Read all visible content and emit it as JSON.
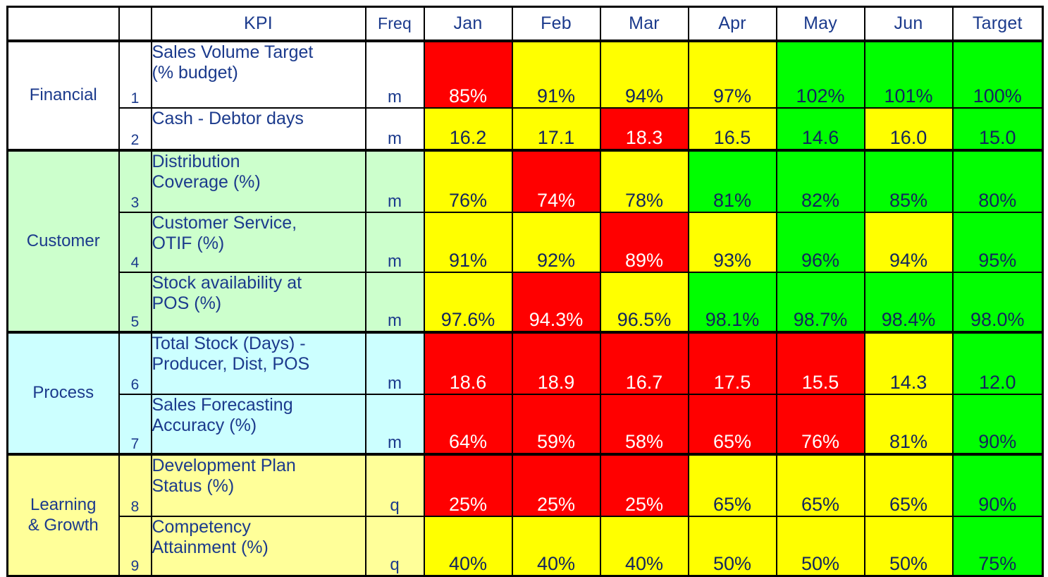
{
  "title": "Balanced Scorecard KPI Table",
  "columns": {
    "perspective": "",
    "number": "",
    "kpi": "KPI",
    "freq": "Freq",
    "months": [
      "Jan",
      "Feb",
      "Mar",
      "Apr",
      "May",
      "Jun"
    ],
    "target": "Target"
  },
  "colors": {
    "red": "#FF0000",
    "yellow": "#FFFF00",
    "green": "#00FF00",
    "text_blue": "#1B3A8C",
    "text_on_red": "#FFFFFF",
    "tint_financial": "#FFFFFF",
    "tint_customer": "#CCFFCC",
    "tint_process": "#CCFFFF",
    "tint_learning": "#FFFF99",
    "border": "#000000"
  },
  "sections": [
    {
      "name": "Financial",
      "tint": "#FFFFFF",
      "rows": [
        {
          "num": "1",
          "kpi": "Sales Volume Target (% budget)",
          "kpi_lines": [
            "Sales Volume Target",
            "(% budget)"
          ],
          "freq": "m",
          "cells": [
            {
              "value": "85%",
              "status": "red"
            },
            {
              "value": "91%",
              "status": "yellow"
            },
            {
              "value": "94%",
              "status": "yellow"
            },
            {
              "value": "97%",
              "status": "yellow"
            },
            {
              "value": "102%",
              "status": "green"
            },
            {
              "value": "101%",
              "status": "green"
            }
          ],
          "target": {
            "value": "100%",
            "status": "green"
          }
        },
        {
          "num": "2",
          "kpi": "Cash - Debtor days",
          "kpi_lines": [
            "Cash - Debtor days"
          ],
          "freq": "m",
          "cells": [
            {
              "value": "16.2",
              "status": "yellow"
            },
            {
              "value": "17.1",
              "status": "yellow"
            },
            {
              "value": "18.3",
              "status": "red"
            },
            {
              "value": "16.5",
              "status": "yellow"
            },
            {
              "value": "14.6",
              "status": "green"
            },
            {
              "value": "16.0",
              "status": "yellow"
            }
          ],
          "target": {
            "value": "15.0",
            "status": "green"
          }
        }
      ]
    },
    {
      "name": "Customer",
      "tint": "#CCFFCC",
      "rows": [
        {
          "num": "3",
          "kpi": "Distribution Coverage (%)",
          "kpi_lines": [
            "Distribution",
            "Coverage (%)"
          ],
          "freq": "m",
          "cells": [
            {
              "value": "76%",
              "status": "yellow"
            },
            {
              "value": "74%",
              "status": "red"
            },
            {
              "value": "78%",
              "status": "yellow"
            },
            {
              "value": "81%",
              "status": "green"
            },
            {
              "value": "82%",
              "status": "green"
            },
            {
              "value": "85%",
              "status": "green"
            }
          ],
          "target": {
            "value": "80%",
            "status": "green"
          }
        },
        {
          "num": "4",
          "kpi": "Customer Service, OTIF (%)",
          "kpi_lines": [
            "Customer Service,",
            "OTIF (%)"
          ],
          "freq": "m",
          "cells": [
            {
              "value": "91%",
              "status": "yellow"
            },
            {
              "value": "92%",
              "status": "yellow"
            },
            {
              "value": "89%",
              "status": "red"
            },
            {
              "value": "93%",
              "status": "yellow"
            },
            {
              "value": "96%",
              "status": "green"
            },
            {
              "value": "94%",
              "status": "yellow"
            }
          ],
          "target": {
            "value": "95%",
            "status": "green"
          }
        },
        {
          "num": "5",
          "kpi": "Stock availability at POS (%)",
          "kpi_lines": [
            "Stock availability at",
            "POS (%)"
          ],
          "freq": "m",
          "cells": [
            {
              "value": "97.6%",
              "status": "yellow"
            },
            {
              "value": "94.3%",
              "status": "red"
            },
            {
              "value": "96.5%",
              "status": "yellow"
            },
            {
              "value": "98.1%",
              "status": "green"
            },
            {
              "value": "98.7%",
              "status": "green"
            },
            {
              "value": "98.4%",
              "status": "green"
            }
          ],
          "target": {
            "value": "98.0%",
            "status": "green"
          }
        }
      ]
    },
    {
      "name": "Process",
      "tint": "#CCFFFF",
      "rows": [
        {
          "num": "6",
          "kpi": "Total Stock (Days) - Producer, Dist, POS",
          "kpi_lines": [
            "Total Stock (Days) -",
            "Producer, Dist, POS"
          ],
          "freq": "m",
          "cells": [
            {
              "value": "18.6",
              "status": "red"
            },
            {
              "value": "18.9",
              "status": "red"
            },
            {
              "value": "16.7",
              "status": "red"
            },
            {
              "value": "17.5",
              "status": "red"
            },
            {
              "value": "15.5",
              "status": "red"
            },
            {
              "value": "14.3",
              "status": "yellow"
            }
          ],
          "target": {
            "value": "12.0",
            "status": "green"
          }
        },
        {
          "num": "7",
          "kpi": "Sales Forecasting Accuracy (%)",
          "kpi_lines": [
            "Sales Forecasting",
            "Accuracy (%)"
          ],
          "freq": "m",
          "cells": [
            {
              "value": "64%",
              "status": "red"
            },
            {
              "value": "59%",
              "status": "red"
            },
            {
              "value": "58%",
              "status": "red"
            },
            {
              "value": "65%",
              "status": "red"
            },
            {
              "value": "76%",
              "status": "red"
            },
            {
              "value": "81%",
              "status": "yellow"
            }
          ],
          "target": {
            "value": "90%",
            "status": "green"
          }
        }
      ]
    },
    {
      "name": "Learning & Growth",
      "tint": "#FFFF99",
      "name_lines": [
        "Learning",
        "& Growth"
      ],
      "rows": [
        {
          "num": "8",
          "kpi": "Development Plan Status (%)",
          "kpi_lines": [
            "Development  Plan",
            "Status (%)"
          ],
          "freq": "q",
          "cells": [
            {
              "value": "25%",
              "status": "red"
            },
            {
              "value": "25%",
              "status": "red"
            },
            {
              "value": "25%",
              "status": "red"
            },
            {
              "value": "65%",
              "status": "yellow"
            },
            {
              "value": "65%",
              "status": "yellow"
            },
            {
              "value": "65%",
              "status": "yellow"
            }
          ],
          "target": {
            "value": "90%",
            "status": "green"
          }
        },
        {
          "num": "9",
          "kpi": "Competency Attainment (%)",
          "kpi_lines": [
            "Competency",
            "Attainment (%)"
          ],
          "freq": "q",
          "cells": [
            {
              "value": "40%",
              "status": "yellow"
            },
            {
              "value": "40%",
              "status": "yellow"
            },
            {
              "value": "40%",
              "status": "yellow"
            },
            {
              "value": "50%",
              "status": "yellow"
            },
            {
              "value": "50%",
              "status": "yellow"
            },
            {
              "value": "50%",
              "status": "yellow"
            }
          ],
          "target": {
            "value": "75%",
            "status": "green"
          }
        }
      ]
    }
  ],
  "chart_data": {
    "type": "table",
    "title": "Balanced Scorecard KPI Table",
    "categories": [
      "Jan",
      "Feb",
      "Mar",
      "Apr",
      "May",
      "Jun",
      "Target"
    ],
    "series": [
      {
        "name": "Sales Volume Target (% budget)",
        "perspective": "Financial",
        "freq": "m",
        "values": [
          "85%",
          "91%",
          "94%",
          "97%",
          "102%",
          "101%",
          "100%"
        ],
        "status": [
          "red",
          "yellow",
          "yellow",
          "yellow",
          "green",
          "green",
          "green"
        ]
      },
      {
        "name": "Cash - Debtor days",
        "perspective": "Financial",
        "freq": "m",
        "values": [
          "16.2",
          "17.1",
          "18.3",
          "16.5",
          "14.6",
          "16.0",
          "15.0"
        ],
        "status": [
          "yellow",
          "yellow",
          "red",
          "yellow",
          "green",
          "yellow",
          "green"
        ]
      },
      {
        "name": "Distribution Coverage (%)",
        "perspective": "Customer",
        "freq": "m",
        "values": [
          "76%",
          "74%",
          "78%",
          "81%",
          "82%",
          "85%",
          "80%"
        ],
        "status": [
          "yellow",
          "red",
          "yellow",
          "green",
          "green",
          "green",
          "green"
        ]
      },
      {
        "name": "Customer Service, OTIF (%)",
        "perspective": "Customer",
        "freq": "m",
        "values": [
          "91%",
          "92%",
          "89%",
          "93%",
          "96%",
          "94%",
          "95%"
        ],
        "status": [
          "yellow",
          "yellow",
          "red",
          "yellow",
          "green",
          "yellow",
          "green"
        ]
      },
      {
        "name": "Stock availability at POS (%)",
        "perspective": "Customer",
        "freq": "m",
        "values": [
          "97.6%",
          "94.3%",
          "96.5%",
          "98.1%",
          "98.7%",
          "98.4%",
          "98.0%"
        ],
        "status": [
          "yellow",
          "red",
          "yellow",
          "green",
          "green",
          "green",
          "green"
        ]
      },
      {
        "name": "Total Stock (Days) - Producer, Dist, POS",
        "perspective": "Process",
        "freq": "m",
        "values": [
          "18.6",
          "18.9",
          "16.7",
          "17.5",
          "15.5",
          "14.3",
          "12.0"
        ],
        "status": [
          "red",
          "red",
          "red",
          "red",
          "red",
          "yellow",
          "green"
        ]
      },
      {
        "name": "Sales Forecasting Accuracy (%)",
        "perspective": "Process",
        "freq": "m",
        "values": [
          "64%",
          "59%",
          "58%",
          "65%",
          "76%",
          "81%",
          "90%"
        ],
        "status": [
          "red",
          "red",
          "red",
          "red",
          "red",
          "yellow",
          "green"
        ]
      },
      {
        "name": "Development Plan Status (%)",
        "perspective": "Learning & Growth",
        "freq": "q",
        "values": [
          "25%",
          "25%",
          "25%",
          "65%",
          "65%",
          "65%",
          "90%"
        ],
        "status": [
          "red",
          "red",
          "red",
          "yellow",
          "yellow",
          "yellow",
          "green"
        ]
      },
      {
        "name": "Competency Attainment (%)",
        "perspective": "Learning & Growth",
        "freq": "q",
        "values": [
          "40%",
          "40%",
          "40%",
          "50%",
          "50%",
          "50%",
          "75%"
        ],
        "status": [
          "yellow",
          "yellow",
          "yellow",
          "yellow",
          "yellow",
          "yellow",
          "green"
        ]
      }
    ]
  }
}
